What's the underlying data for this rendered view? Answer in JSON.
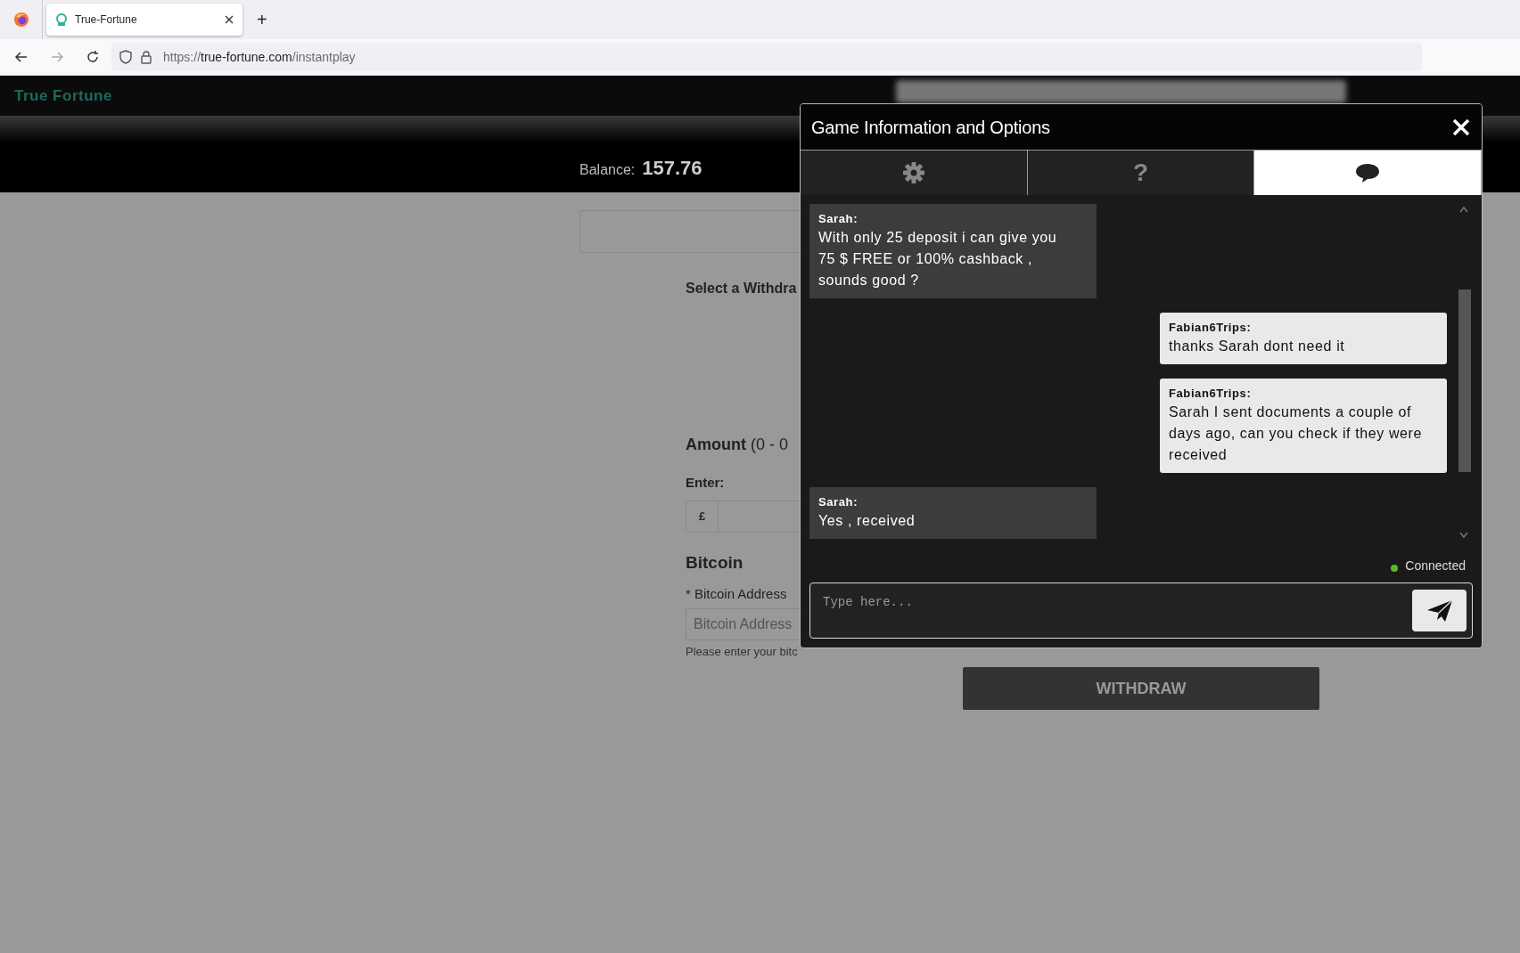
{
  "browser": {
    "tab": {
      "title": "True-Fortune",
      "selected": true
    },
    "new_tab": "+",
    "url": {
      "scheme": "https://",
      "host": "true-fortune.com",
      "path": "/instantplay"
    }
  },
  "site": {
    "logo": "True Fortune",
    "balance_label": "Balance:",
    "balance": "157.76"
  },
  "withdraw_form": {
    "heading": "Select a Withdra",
    "amount_label": "Amount",
    "amount_range": "(0 - 0",
    "enter_label": "Enter:",
    "currency": "£",
    "method_title": "Bitcoin",
    "address_label": "* Bitcoin Address",
    "address_placeholder": "Bitcoin Address",
    "help": "Please enter your bitc",
    "button": "WITHDRAW"
  },
  "modal": {
    "title": "Game Information and Options",
    "tabs": [
      {
        "kind": "gear",
        "selected": false
      },
      {
        "kind": "text",
        "label": "?",
        "selected": false
      },
      {
        "kind": "chat",
        "selected": true
      }
    ],
    "messages": [
      {
        "kind": "agent",
        "sender": "Sarah:",
        "text": "With only 25 deposit i can give you 75 $ FREE or 100% cashback , sounds good ?"
      },
      {
        "kind": "user",
        "sender": "Fabian6Trips:",
        "text": "thanks Sarah dont need it"
      },
      {
        "kind": "user",
        "sender": "Fabian6Trips:",
        "text": "Sarah I sent documents a couple of days ago, can you check if they were received"
      },
      {
        "kind": "agent",
        "sender": "Sarah:",
        "text": "Yes , received"
      }
    ],
    "status": {
      "text": "Connected",
      "connected": true
    },
    "input": {
      "placeholder": "Type here..."
    }
  }
}
